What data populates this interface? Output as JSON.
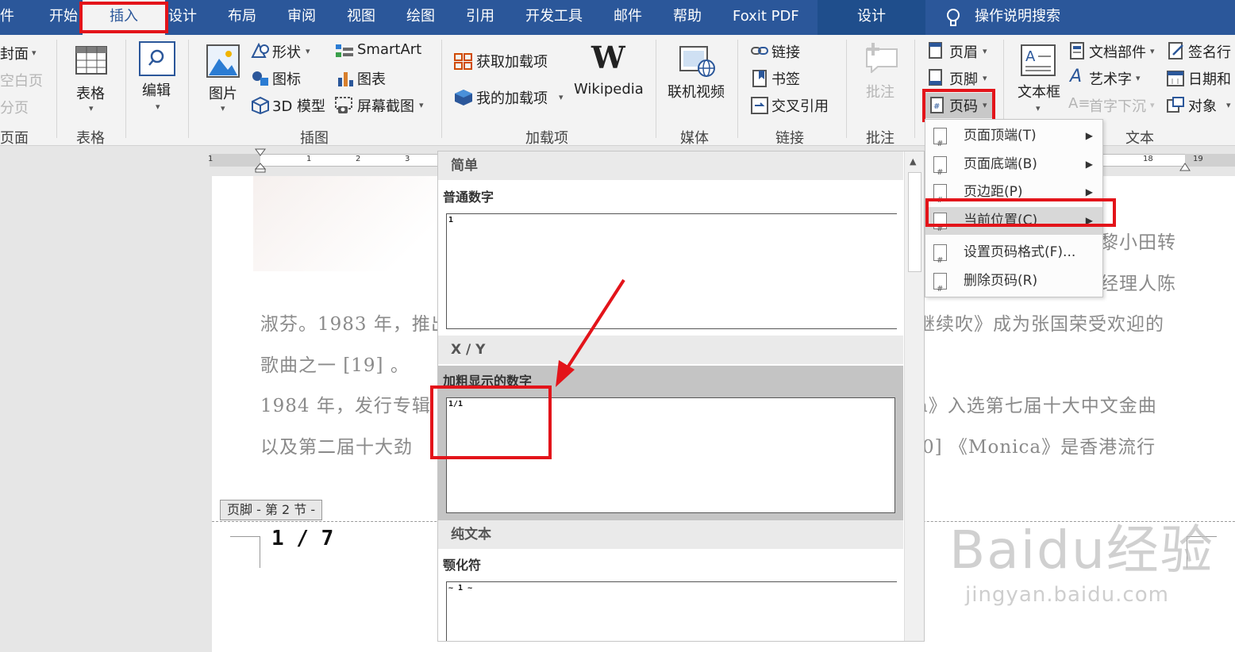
{
  "tabs": [
    "件",
    "开始",
    "插入",
    "设计",
    "布局",
    "审阅",
    "视图",
    "绘图",
    "引用",
    "开发工具",
    "邮件",
    "帮助",
    "Foxit PDF",
    "设计"
  ],
  "tell_me": "操作说明搜索",
  "ribbon": {
    "pages": {
      "cover": "封面",
      "blank": "空白页",
      "break": "分页",
      "group": "页面"
    },
    "table": {
      "button": "表格",
      "group": "表格"
    },
    "edit": {
      "button": "编辑"
    },
    "illus": {
      "picture": "图片",
      "shapes": "形状",
      "icons": "图标",
      "model3d": "3D 模型",
      "smartart": "SmartArt",
      "chart": "图表",
      "screenshot": "屏幕截图",
      "group": "插图"
    },
    "addins": {
      "get": "获取加载项",
      "my": "我的加载项",
      "wikipedia": "Wikipedia",
      "group": "加载项"
    },
    "media": {
      "video": "联机视频",
      "group": "媒体"
    },
    "links": {
      "link": "链接",
      "bookmark": "书签",
      "xref": "交叉引用",
      "group": "链接"
    },
    "comments": {
      "comment": "批注",
      "group": "批注"
    },
    "hf": {
      "header": "页眉",
      "footer": "页脚",
      "pagenum": "页码"
    },
    "text": {
      "textbox": "文本框",
      "parts": "文档部件",
      "wordart": "艺术字",
      "dropcap": "首字下沉",
      "signature": "签名行",
      "datetime": "日期和",
      "object": "对象",
      "group": "文本"
    }
  },
  "ruler_ticks": [
    "1",
    "1",
    "2",
    "3",
    "18",
    "19"
  ],
  "document": {
    "lines": [
      "黎小田转",
      "经理人陈",
      "淑芬。1983 年，推出",
      "继续吹》成为张国荣受欢迎的",
      "歌曲之一 [19]  。",
      "1984 年，发行专辑",
      "a》入选第七届十大中文金曲",
      "以及第二届十大劲",
      "0]  《Monica》是香港流行"
    ],
    "footer_tag": "页脚 - 第 2 节 -",
    "page_number": "1 / 7"
  },
  "gallery": {
    "sections": [
      {
        "header": "简单",
        "name": "普通数字",
        "preview": "1"
      },
      {
        "header": "X / Y",
        "name": "加粗显示的数字",
        "preview": "1/1"
      },
      {
        "header": "纯文本",
        "name": "颚化符",
        "preview": "~ 1 ~"
      }
    ]
  },
  "menu": {
    "items": [
      "页面顶端(T)",
      "页面底端(B)",
      "页边距(P)",
      "当前位置(C)",
      "设置页码格式(F)...",
      "删除页码(R)"
    ]
  },
  "watermark": {
    "logo": "Baidu经验",
    "url": "jingyan.baidu.com"
  },
  "colors": {
    "tabbar": "#2b579a",
    "highlight": "#e3141a"
  }
}
